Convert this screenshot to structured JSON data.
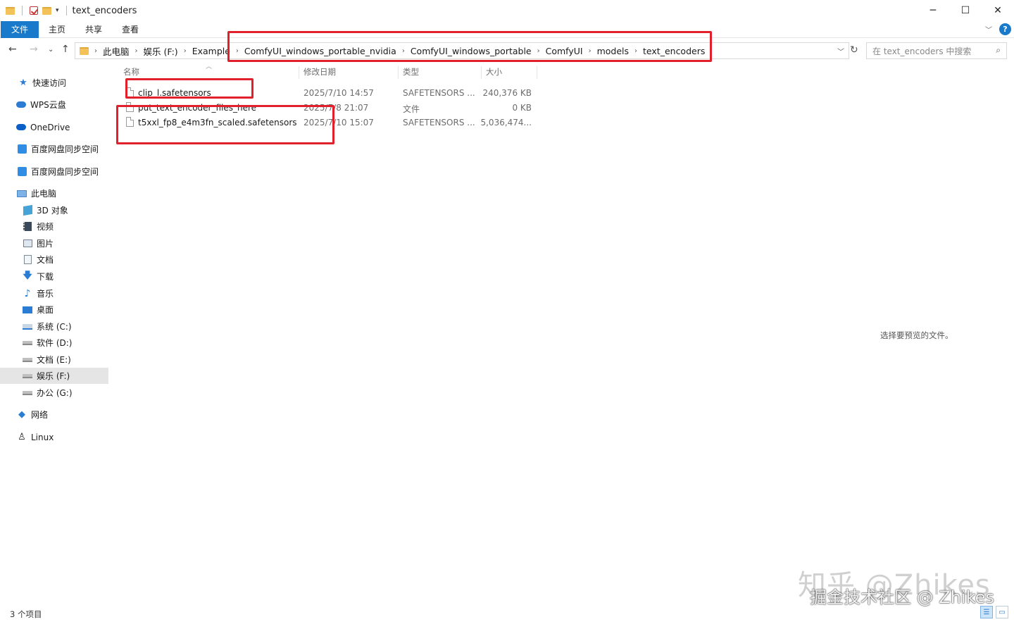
{
  "window": {
    "title": "text_encoders",
    "controls": [
      "─",
      "☐",
      "✕"
    ]
  },
  "ribbon": {
    "tabs": [
      "文件",
      "主页",
      "共享",
      "查看"
    ]
  },
  "address": {
    "crumbs": [
      "此电脑",
      "娱乐 (F:)",
      "Example",
      "ComfyUI_windows_portable_nvidia",
      "ComfyUI_windows_portable",
      "ComfyUI",
      "models",
      "text_encoders"
    ]
  },
  "search": {
    "placeholder": "在 text_encoders 中搜索"
  },
  "sidebar": {
    "items": [
      {
        "label": "快速访问",
        "icon": "star-icon"
      },
      {
        "label": "WPS云盘",
        "icon": "cloud-icon"
      },
      {
        "label": "OneDrive",
        "icon": "onedrive-icon"
      },
      {
        "label": "百度网盘同步空间",
        "icon": "baidu-icon"
      },
      {
        "label": "百度网盘同步空间",
        "icon": "baidu-icon"
      },
      {
        "label": "此电脑",
        "icon": "computer-icon"
      },
      {
        "label": "3D 对象",
        "icon": "cube-icon"
      },
      {
        "label": "视频",
        "icon": "video-icon"
      },
      {
        "label": "图片",
        "icon": "picture-icon"
      },
      {
        "label": "文档",
        "icon": "document-icon"
      },
      {
        "label": "下载",
        "icon": "download-icon"
      },
      {
        "label": "音乐",
        "icon": "music-icon"
      },
      {
        "label": "桌面",
        "icon": "desktop-icon"
      },
      {
        "label": "系统 (C:)",
        "icon": "system-drive-icon"
      },
      {
        "label": "软件 (D:)",
        "icon": "drive-icon"
      },
      {
        "label": "文档 (E:)",
        "icon": "drive-icon"
      },
      {
        "label": "娱乐 (F:)",
        "icon": "drive-icon",
        "selected": true
      },
      {
        "label": "办公 (G:)",
        "icon": "drive-icon"
      },
      {
        "label": "网络",
        "icon": "network-icon"
      },
      {
        "label": "Linux",
        "icon": "linux-icon"
      }
    ]
  },
  "columns": {
    "name": "名称",
    "modified": "修改日期",
    "type": "类型",
    "size": "大小"
  },
  "files": [
    {
      "name": "clip_l.safetensors",
      "modified": "2025/7/10 14:57",
      "type": "SAFETENSORS ...",
      "size": "240,376 KB"
    },
    {
      "name": "put_text_encoder_files_here",
      "modified": "2025/7/8 21:07",
      "type": "文件",
      "size": "0 KB"
    },
    {
      "name": "t5xxl_fp8_e4m3fn_scaled.safetensors",
      "modified": "2025/7/10 15:07",
      "type": "SAFETENSORS ...",
      "size": "5,036,474..."
    }
  ],
  "preview": {
    "message": "选择要预览的文件。"
  },
  "status": {
    "count": "3 个项目"
  },
  "watermarks": {
    "zhihu": "知乎 @Zhikes",
    "juejin": "掘金技术社区 @ Zhikes"
  },
  "colors": {
    "accent": "#1979ca",
    "annotation": "#e0202a"
  }
}
